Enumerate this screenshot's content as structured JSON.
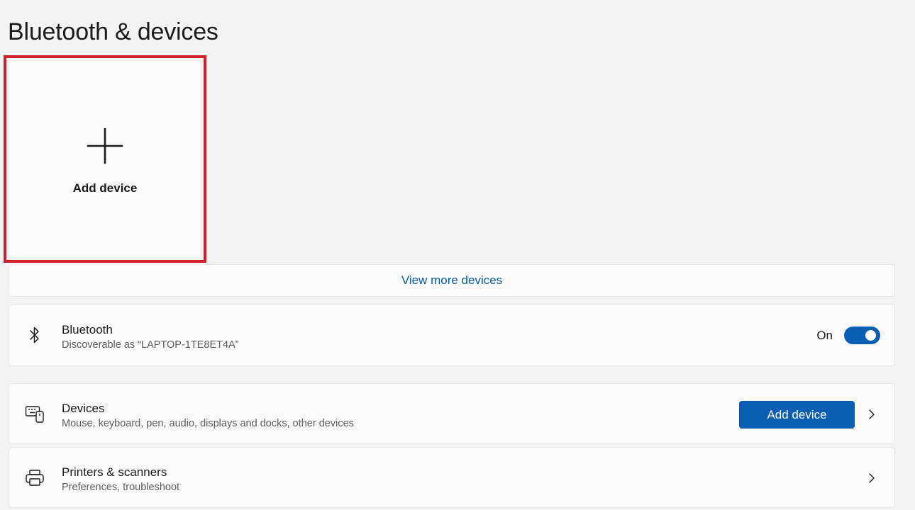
{
  "page": {
    "title": "Bluetooth & devices"
  },
  "add_tile": {
    "label": "Add device",
    "icon": "plus-icon"
  },
  "view_more": {
    "label": "View more devices"
  },
  "bluetooth": {
    "icon": "bluetooth-icon",
    "title": "Bluetooth",
    "subtitle": "Discoverable as “LAPTOP-1TE8ET4A”",
    "toggle_label": "On",
    "toggle_on": true
  },
  "devices": {
    "icon": "keyboard-devices-icon",
    "title": "Devices",
    "subtitle": "Mouse, keyboard, pen, audio, displays and docks, other devices",
    "button_label": "Add device"
  },
  "printers": {
    "icon": "printer-icon",
    "title": "Printers & scanners",
    "subtitle": "Preferences, troubleshoot"
  },
  "colors": {
    "accent": "#0a5fb4",
    "link": "#0a5a9c",
    "highlight": "#d0202a",
    "background": "#f3f3f3",
    "card": "#fbfbfb"
  }
}
